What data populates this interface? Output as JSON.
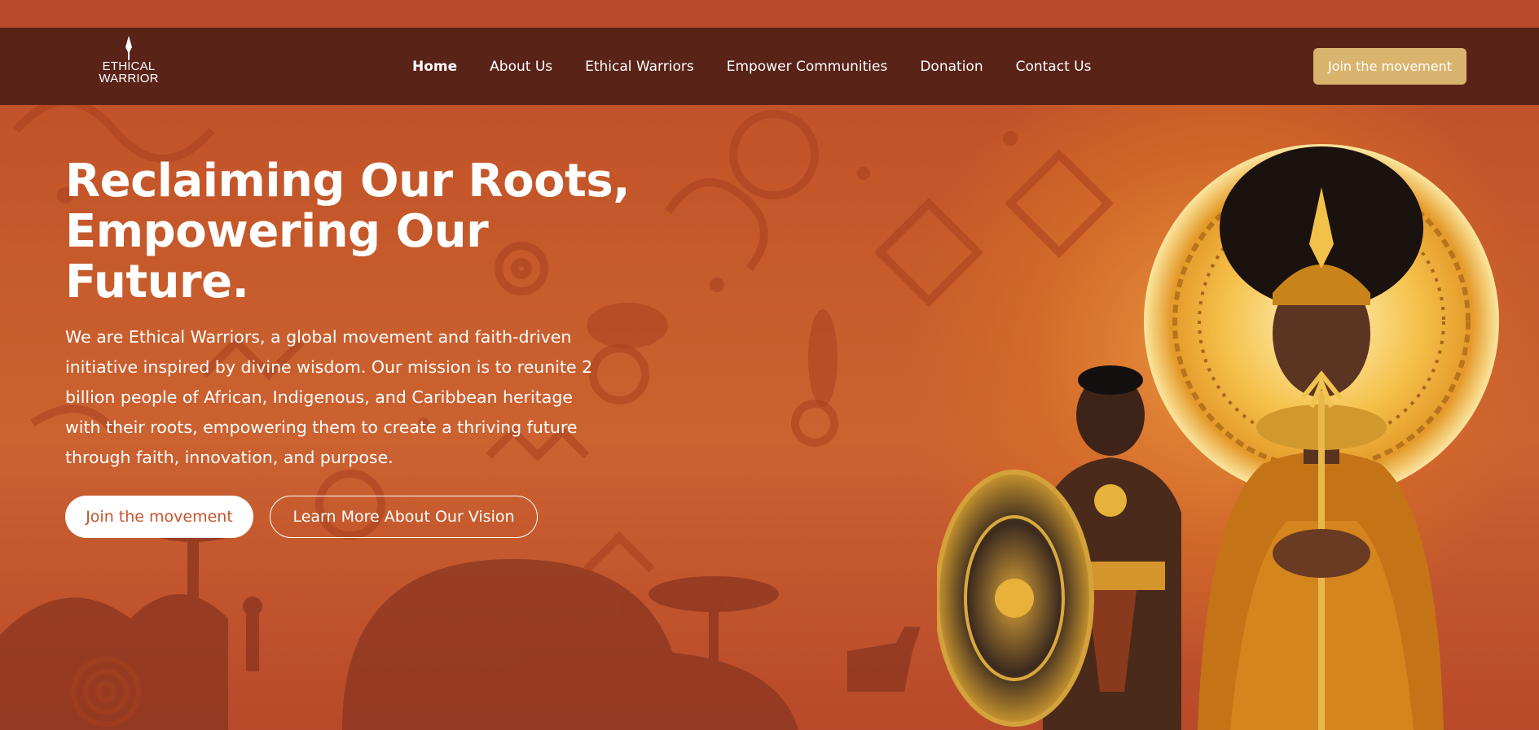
{
  "brand": {
    "logo_line1": "ETHICAL",
    "logo_line2": "WARRIOR",
    "icon": "spear-icon"
  },
  "nav": {
    "items": [
      {
        "label": "Home",
        "active": true
      },
      {
        "label": "About Us",
        "active": false
      },
      {
        "label": "Ethical Warriors",
        "active": false
      },
      {
        "label": "Empower Communities",
        "active": false
      },
      {
        "label": "Donation",
        "active": false
      },
      {
        "label": "Contact Us",
        "active": false
      }
    ],
    "cta_label": "Join the movement"
  },
  "hero": {
    "title_lines": [
      "Reclaiming Our Roots,",
      "Empowering Our",
      "Future."
    ],
    "description_lines": [
      "We are Ethical Warriors, a global movement and faith-driven",
      "initiative inspired by divine wisdom. Our mission is to reunite 2",
      "billion people of African, Indigenous, and Caribbean heritage",
      "with their roots, empowering them to create a thriving future",
      "through faith, innovation, and purpose."
    ],
    "primary_button": "Join the movement",
    "secondary_button": "Learn More About Our Vision"
  },
  "colors": {
    "background": "#c2532a",
    "navbar": "#5a2318",
    "nav_cta": "#d9b46e",
    "primary_button_text": "#c4532a",
    "glow": "#f0a840"
  }
}
